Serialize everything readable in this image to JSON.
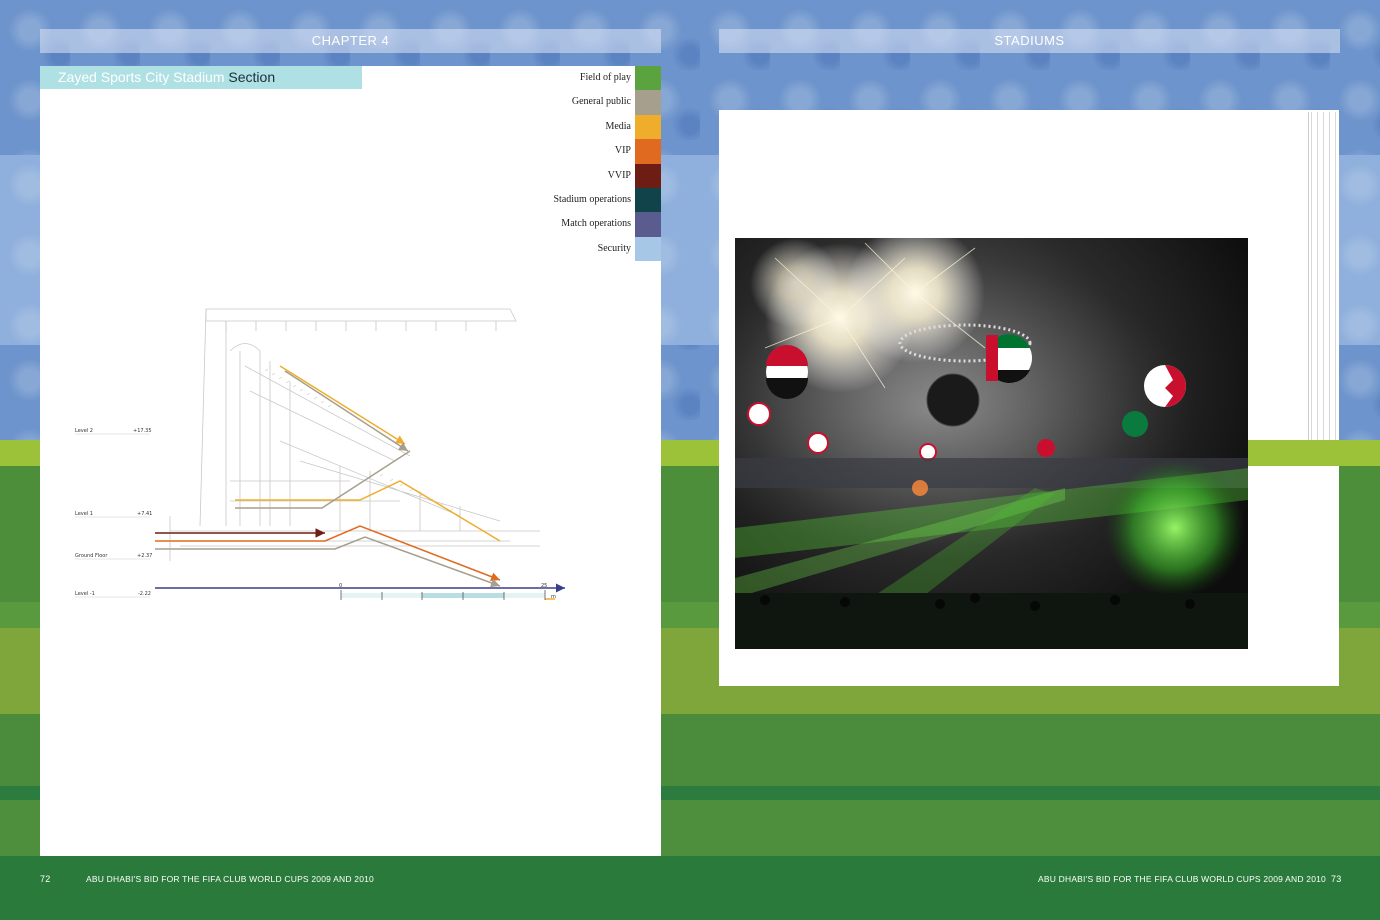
{
  "header": {
    "left_label": "CHAPTER 4",
    "right_label": "STADIUMS"
  },
  "section": {
    "title_main": "Zayed Sports City Stadium",
    "title_sub": "Section"
  },
  "legend": {
    "items": [
      {
        "label": "Field of play",
        "color": "#5aa33f"
      },
      {
        "label": "General public",
        "color": "#a79f8d"
      },
      {
        "label": "Media",
        "color": "#f0ad2c"
      },
      {
        "label": "VIP",
        "color": "#e06a1f"
      },
      {
        "label": "VVIP",
        "color": "#6e1d14"
      },
      {
        "label": "Stadium operations",
        "color": "#10434a"
      },
      {
        "label": "Match operations",
        "color": "#5a5b8f"
      },
      {
        "label": "Security",
        "color": "#a6c8e6"
      }
    ]
  },
  "diagram": {
    "levels": [
      {
        "name": "Level 2",
        "value": "+17.35"
      },
      {
        "name": "Level 1",
        "value": "+7.41"
      },
      {
        "name": "Ground Floor",
        "value": "+2.37"
      },
      {
        "name": "Level -1",
        "value": "-2.22"
      }
    ],
    "scale": {
      "start": "0",
      "end": "25",
      "unit": "m"
    }
  },
  "footer": {
    "left_page_number": "72",
    "left_title": "ABU DHABI'S BID FOR THE FIFA CLUB WORLD CUPS 2009 AND 2010",
    "right_title": "ABU DHABI'S BID FOR THE FIFA CLUB WORLD CUPS 2009 AND 2010",
    "right_page_number": "73"
  }
}
